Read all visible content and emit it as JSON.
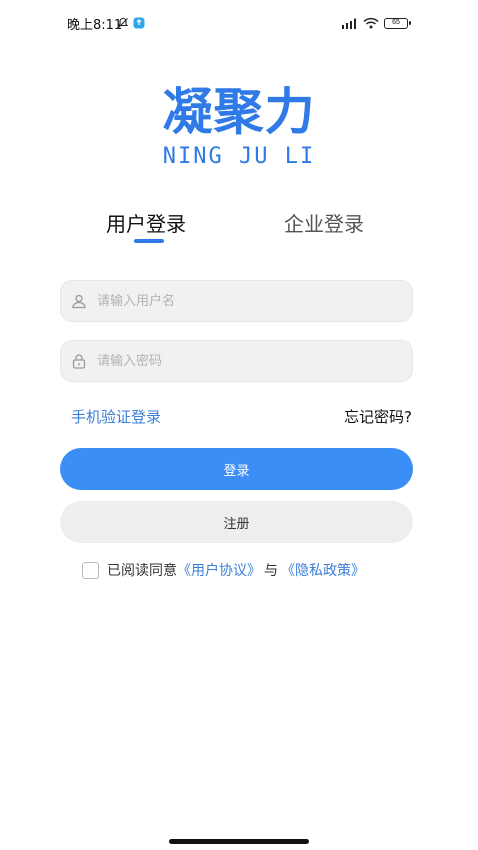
{
  "status_bar": {
    "time": "晚上8:11",
    "battery": "65",
    "icons": [
      "mute-bell-icon",
      "app-notification-icon",
      "signal-icon",
      "wifi-icon",
      "battery-icon"
    ]
  },
  "logo": {
    "chinese": "凝聚力",
    "english": "NING JU LI"
  },
  "tabs": [
    {
      "label": "用户登录",
      "active": true
    },
    {
      "label": "企业登录",
      "active": false
    }
  ],
  "form": {
    "username_placeholder": "请输入用户名",
    "username_value": "",
    "password_placeholder": "请输入密码",
    "password_value": "",
    "sms_login_label": "手机验证登录",
    "forgot_password_label": "忘记密码?"
  },
  "buttons": {
    "login_label": "登录",
    "register_label": "注册"
  },
  "agreement": {
    "checked": false,
    "prefix": "已阅读同意",
    "user_agreement": "《用户协议》",
    "and": "与",
    "privacy_policy": "《隐私政策》"
  },
  "colors": {
    "accent": "#3b8ef5",
    "link": "#3a7fd9",
    "logo": "#2f7ae6"
  }
}
